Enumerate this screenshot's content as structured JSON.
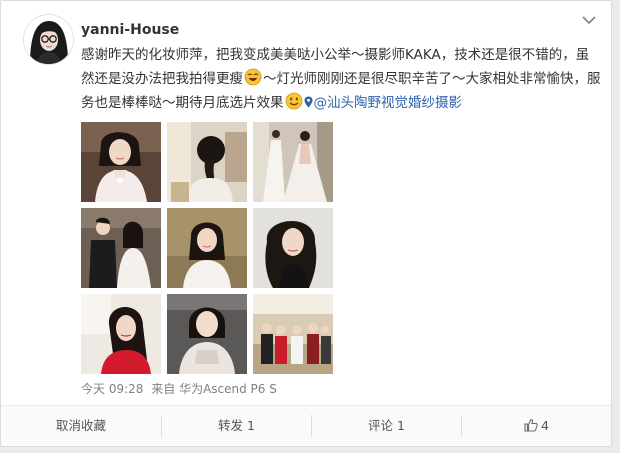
{
  "post": {
    "username": "yanni-House",
    "text_part1": "感谢昨天的化妆师萍，把我变成美美哒小公举～摄影师KAKA，技术还是很不错的，虽然还是没办法把我拍得更瘦",
    "text_part2": "～灯光师刚刚还是很尽职辛苦了～大家相处非常愉快，服务也是棒棒哒～期待月底选片效果",
    "location_text": "@汕头陶野视觉婚纱摄影",
    "emoji_1": "laughing-tears-emoji",
    "emoji_2": "smile-emoji",
    "time": "今天 09:28",
    "source_prefix": "来自",
    "source_device": "华为Ascend P6 S",
    "photo_count": 9
  },
  "actions": {
    "favorite_label": "取消收藏",
    "repost_label": "转发 1",
    "comment_label": "评论 1",
    "like_count": "4"
  },
  "icons": {
    "menu": "chevron-down-icon",
    "like": "thumbs-up-icon",
    "location": "location-pin-icon"
  },
  "colors": {
    "link": "#2e63ab",
    "text": "#333333",
    "meta": "#808080"
  }
}
